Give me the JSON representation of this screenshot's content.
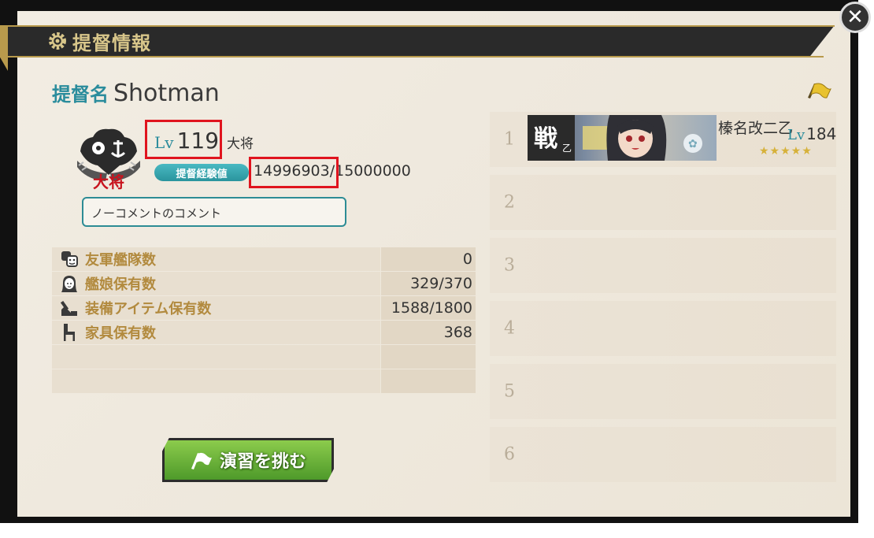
{
  "header": {
    "title": "提督情報",
    "close": "✕"
  },
  "admiral": {
    "name_label": "提督名",
    "name": "Shotman",
    "level_label": "Lv",
    "level": "119",
    "rank": "大将",
    "emblem_text": "大将",
    "exp_label": "提督経験値",
    "exp_current": "14996903",
    "exp_separator": "/",
    "exp_max": "15000000",
    "comment": "ノーコメントのコメント"
  },
  "stats": [
    {
      "icon": "friend-fleet-icon",
      "label": "友軍艦隊数",
      "value": "0"
    },
    {
      "icon": "shipgirl-icon",
      "label": "艦娘保有数",
      "value": "329/370"
    },
    {
      "icon": "equipment-icon",
      "label": "装備アイテム保有数",
      "value": "1588/1800"
    },
    {
      "icon": "furniture-icon",
      "label": "家具保有数",
      "value": "368"
    }
  ],
  "exercise_button": {
    "label": "演習を挑む"
  },
  "fleet": {
    "slots": [
      {
        "num": "1",
        "ship_name": "榛名改二乙",
        "lv_label": "Lv",
        "lv": "184",
        "stars": "★★★★★",
        "class_tag": "戦",
        "class_sub": "乙"
      },
      {
        "num": "2"
      },
      {
        "num": "3"
      },
      {
        "num": "4"
      },
      {
        "num": "5"
      },
      {
        "num": "6"
      }
    ]
  },
  "colors": {
    "accent_teal": "#2a8c9c",
    "gold": "#b28a3e",
    "highlight_red": "#e0141e",
    "button_green": "#5ea830"
  }
}
